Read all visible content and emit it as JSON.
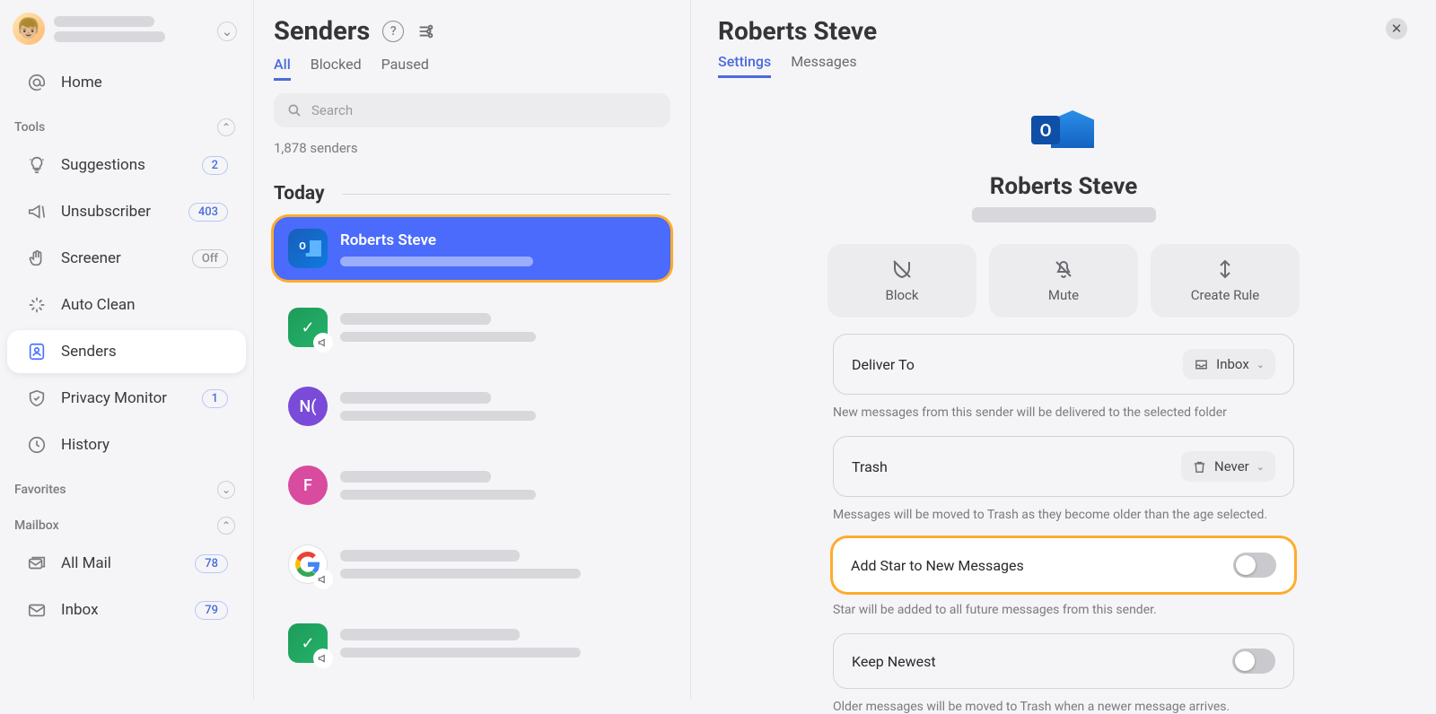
{
  "sidebar": {
    "home": "Home",
    "sections": {
      "tools": "Tools",
      "favorites": "Favorites",
      "mailbox": "Mailbox"
    },
    "tools": {
      "suggestions": {
        "label": "Suggestions",
        "badge": "2"
      },
      "unsubscriber": {
        "label": "Unsubscriber",
        "badge": "403"
      },
      "screener": {
        "label": "Screener",
        "badge": "Off"
      },
      "autoclean": {
        "label": "Auto Clean"
      },
      "senders": {
        "label": "Senders"
      },
      "privacy": {
        "label": "Privacy Monitor",
        "badge": "1"
      },
      "history": {
        "label": "History"
      }
    },
    "mailbox": {
      "allmail": {
        "label": "All Mail",
        "badge": "78"
      },
      "inbox": {
        "label": "Inbox",
        "badge": "79"
      }
    }
  },
  "middle": {
    "title": "Senders",
    "tabs": {
      "all": "All",
      "blocked": "Blocked",
      "paused": "Paused"
    },
    "search_placeholder": "Search",
    "count": "1,878 senders",
    "group": "Today",
    "items": {
      "roberts": {
        "name": "Roberts Steve"
      },
      "n": {
        "initials": "N("
      },
      "f": {
        "initials": "F"
      }
    }
  },
  "detail": {
    "title": "Roberts Steve",
    "tabs": {
      "settings": "Settings",
      "messages": "Messages"
    },
    "name": "Roberts Steve",
    "actions": {
      "block": "Block",
      "mute": "Mute",
      "rule": "Create Rule"
    },
    "deliver": {
      "label": "Deliver To",
      "value": "Inbox",
      "help": "New messages from this sender will be delivered to the selected folder"
    },
    "trash": {
      "label": "Trash",
      "value": "Never",
      "help": "Messages will be moved to Trash as they become older than the age selected."
    },
    "star": {
      "label": "Add Star to New Messages",
      "help": "Star will be added to all future messages from this sender."
    },
    "keep": {
      "label": "Keep Newest",
      "help": "Older messages will be moved to Trash when a newer message arrives."
    }
  }
}
